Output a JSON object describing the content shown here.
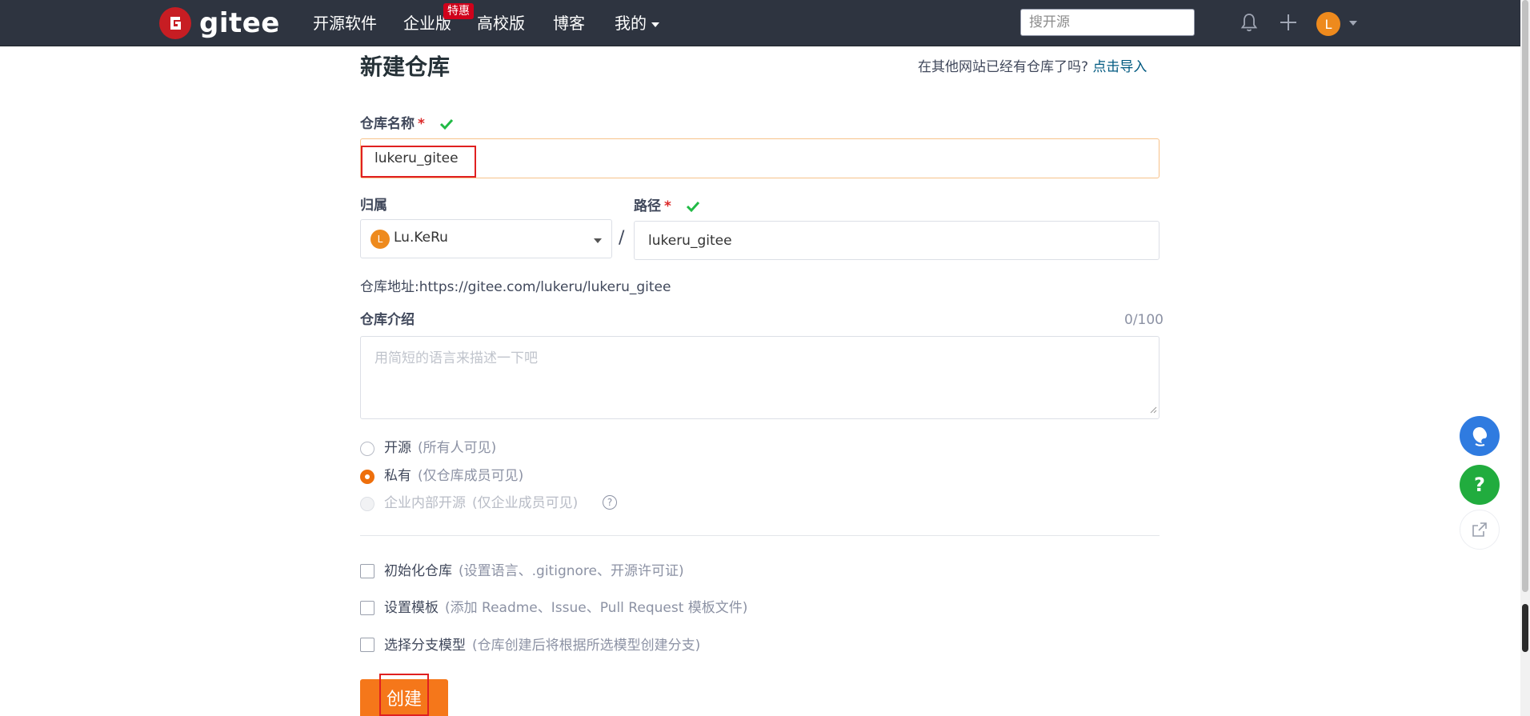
{
  "nav": {
    "logo_text": "gitee",
    "items": [
      "开源软件",
      "企业版",
      "高校版",
      "博客",
      "我的"
    ],
    "badge": "特惠",
    "search_placeholder": "搜开源",
    "avatar_letter": "L"
  },
  "form": {
    "title": "新建仓库",
    "import_prompt": "在其他网站已经有仓库了吗?",
    "import_link": "点击导入",
    "repo_name_label": "仓库名称",
    "required_mark": "*",
    "repo_name_value": "lukeru_gitee",
    "owner_label": "归属",
    "owner_avatar_letter": "L",
    "owner_value": "Lu.KeRu",
    "slash": "/",
    "path_label": "路径",
    "path_value": "lukeru_gitee",
    "address_label": "仓库地址:",
    "address_value": "https://gitee.com/lukeru/lukeru_gitee",
    "intro_label": "仓库介绍",
    "intro_count": "0/100",
    "intro_placeholder": "用简短的语言来描述一下吧",
    "visibility": [
      {
        "label": "开源",
        "note": "(所有人可见)",
        "checked": false,
        "disabled": false
      },
      {
        "label": "私有",
        "note": "(仅仓库成员可见)",
        "checked": true,
        "disabled": false
      },
      {
        "label": "企业内部开源",
        "note": "(仅企业成员可见)",
        "checked": false,
        "disabled": true
      }
    ],
    "options": [
      {
        "label": "初始化仓库",
        "note": "(设置语言、.gitignore、开源许可证)"
      },
      {
        "label": "设置模板",
        "note": "(添加 Readme、Issue、Pull Request 模板文件)"
      },
      {
        "label": "选择分支模型",
        "note": "(仓库创建后将根据所选模型创建分支)"
      }
    ],
    "submit_label": "创建"
  },
  "floating": {
    "help_label": "?"
  },
  "colors": {
    "nav_bg": "#2e3440",
    "accent": "#f5771a",
    "brand_red": "#c71d23",
    "link": "#005980",
    "valid": "#21ba45",
    "highlight": "#e02020"
  }
}
